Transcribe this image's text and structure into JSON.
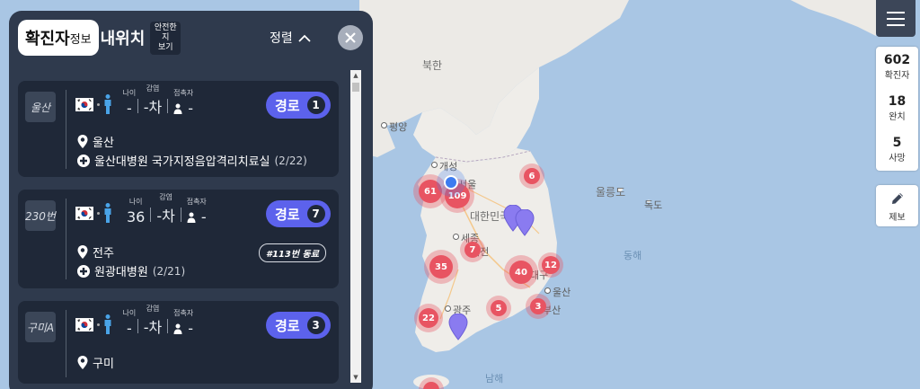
{
  "map": {
    "labels": {
      "north_korea": "북한",
      "pyongyang": "평양",
      "kaesong": "개성",
      "seoul": "서울",
      "south_korea": "대한민국",
      "sejong": "세종",
      "daejeon": "대전",
      "gwangju": "광주",
      "ulsan": "울산",
      "busan": "부산",
      "ulleungdo": "울릉도",
      "dokdo": "독도",
      "east_sea": "동해",
      "south_sea": "남해",
      "daegu": "대구"
    },
    "clusters": [
      {
        "id": "incheon",
        "count": "61"
      },
      {
        "id": "seoul",
        "count": "109"
      },
      {
        "id": "gangneung",
        "count": "6"
      },
      {
        "id": "sejong",
        "count": "7"
      },
      {
        "id": "jeonju",
        "count": "35"
      },
      {
        "id": "daegu",
        "count": "40"
      },
      {
        "id": "pohang",
        "count": "12"
      },
      {
        "id": "jinju",
        "count": "5"
      },
      {
        "id": "busan",
        "count": "3"
      },
      {
        "id": "gwangju",
        "count": "22"
      }
    ],
    "colors": {
      "cluster": "#e85462",
      "pin": "#8a7bf0",
      "my_location": "#3d7cf0"
    }
  },
  "panel": {
    "tab_confirmed_big": "확진자",
    "tab_confirmed_small": "정보",
    "tab_mine": "내위치",
    "tab_safe_lines": [
      "안전한",
      "지",
      "보기"
    ],
    "sort_label": "정렬",
    "field_labels": {
      "age": "나이",
      "infect": "감염",
      "contacts": "접촉자"
    },
    "route_label": "경로",
    "cards": [
      {
        "id": "울산",
        "age": "-",
        "infect": "-차",
        "contacts": "-",
        "routes": "1",
        "location": "울산",
        "hospital": "울산대병원 국가지정음압격리치료실",
        "date": "(2/22)",
        "tag": ""
      },
      {
        "id": "230번",
        "age": "36",
        "infect": "-차",
        "contacts": "-",
        "routes": "7",
        "location": "전주",
        "hospital": "원광대병원",
        "date": "(2/21)",
        "tag": "#113번 동료"
      },
      {
        "id": "구미A",
        "age": "-",
        "infect": "-차",
        "contacts": "-",
        "routes": "3",
        "location": "구미",
        "hospital": "",
        "date": "",
        "tag": ""
      }
    ]
  },
  "stats": {
    "confirmed": {
      "num": "602",
      "label": "확진자"
    },
    "recovered": {
      "num": "18",
      "label": "완치"
    },
    "deaths": {
      "num": "5",
      "label": "사망"
    }
  },
  "report_label": "제보",
  "icons": {
    "menu": "hamburger-icon",
    "close": "close-icon",
    "sort": "chevron-up-icon",
    "report": "pencil-icon"
  }
}
